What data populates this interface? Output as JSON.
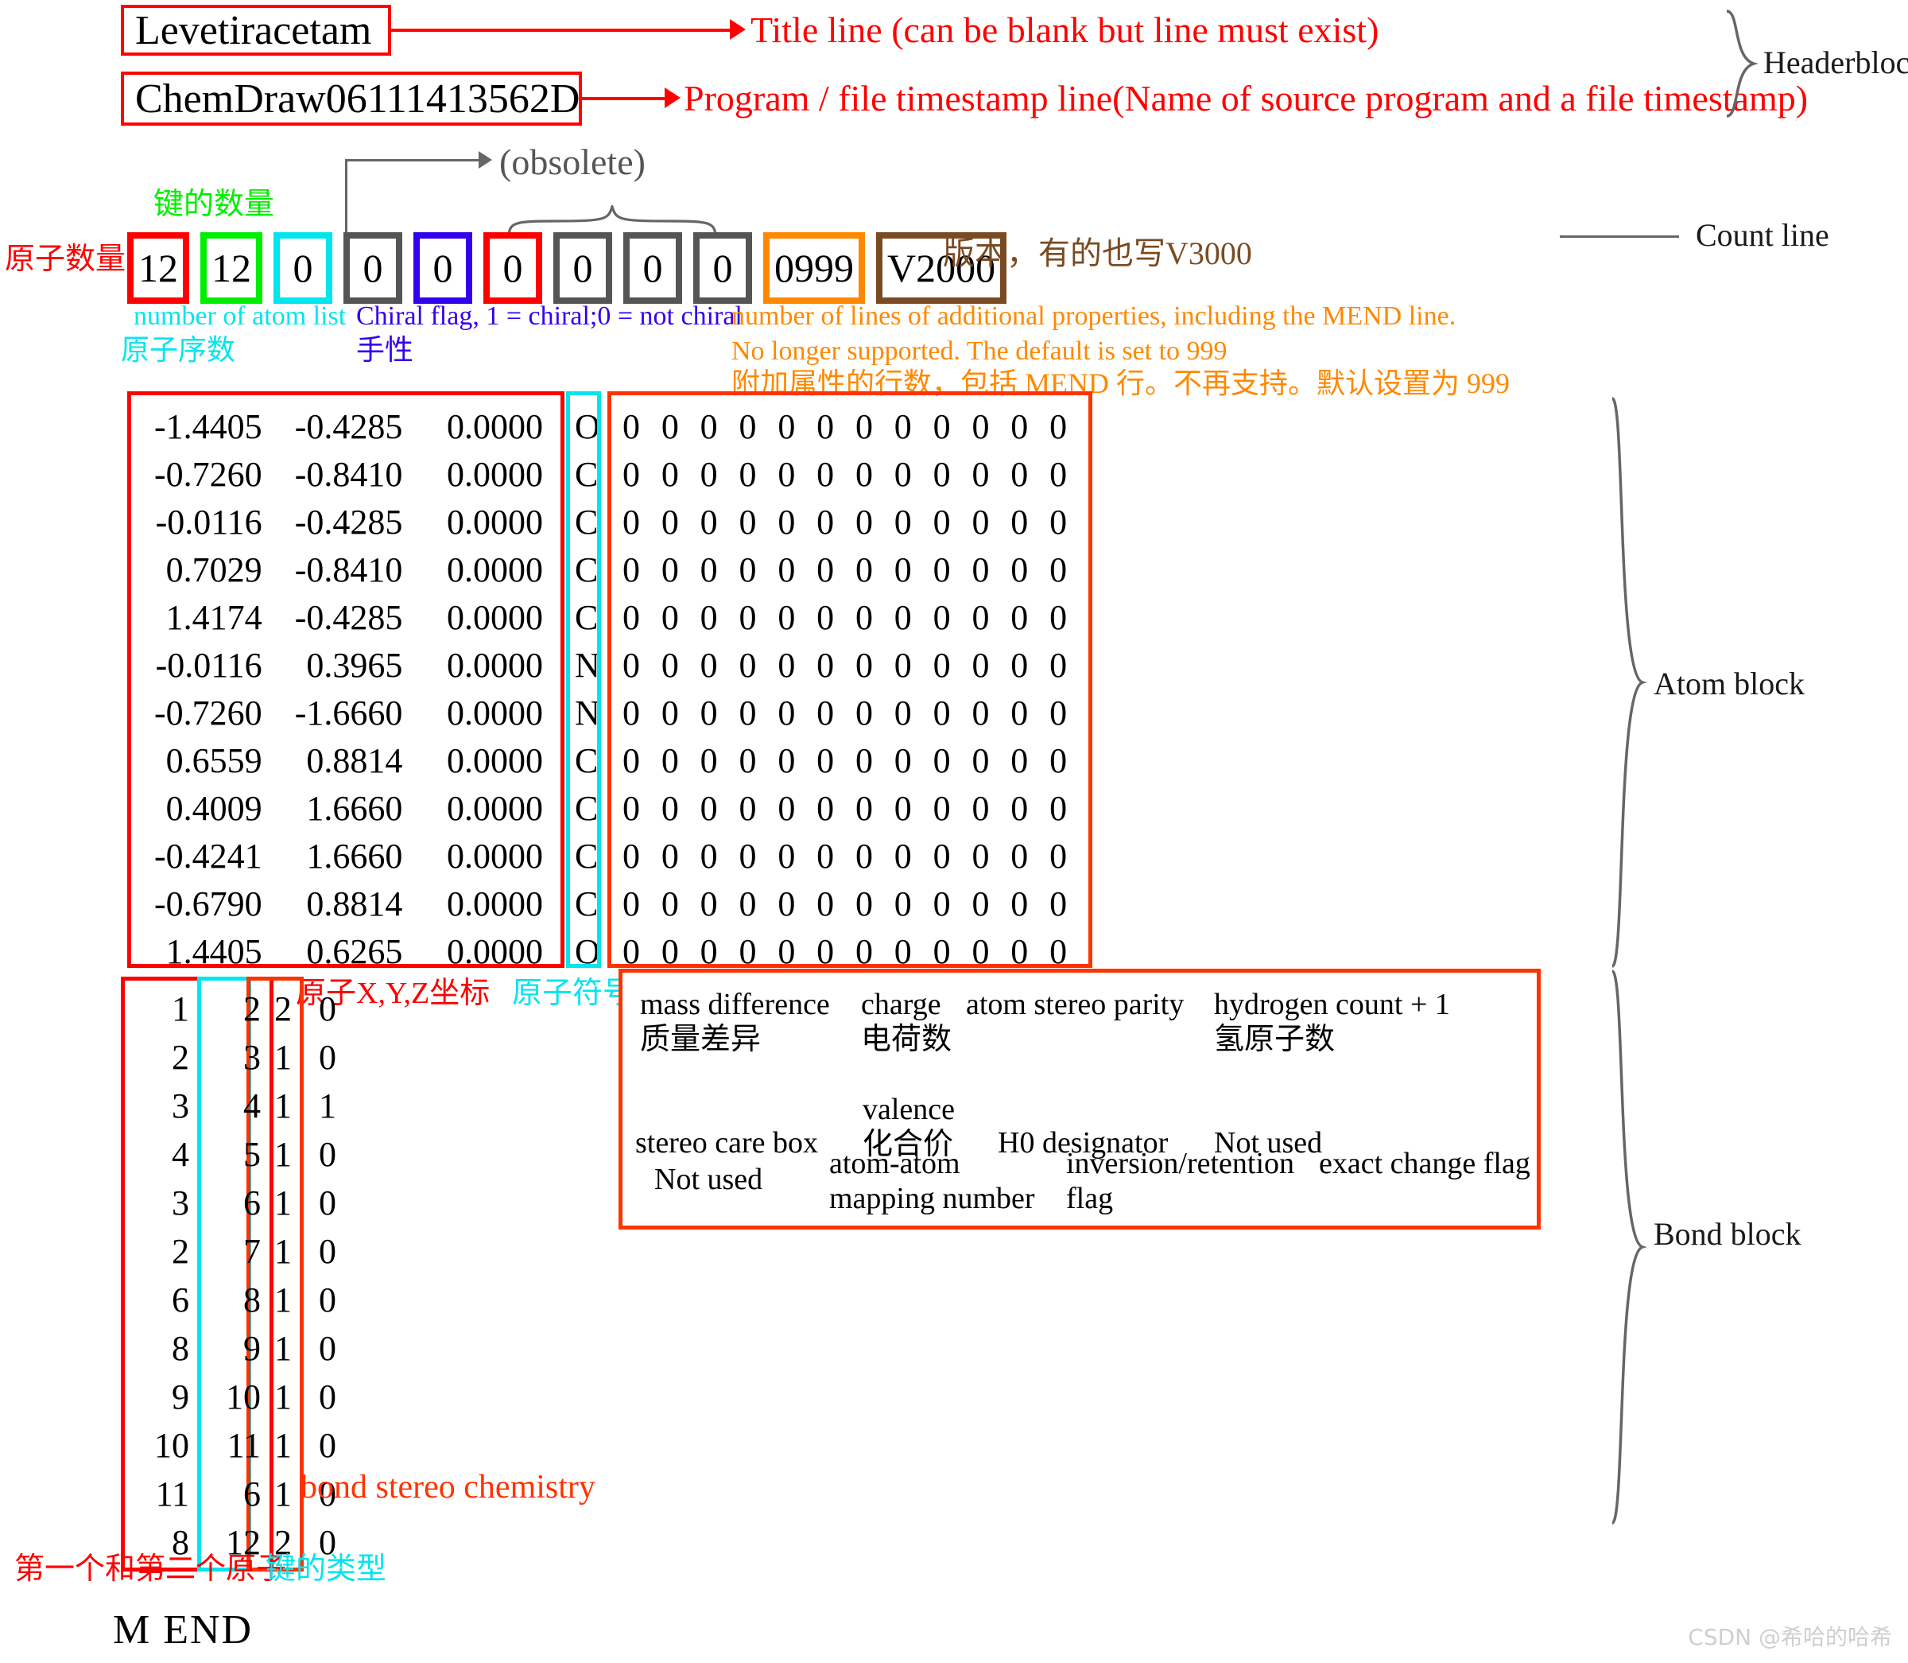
{
  "header": {
    "title_line": "Levetiracetam",
    "program_line": "ChemDraw06111413562D",
    "title_annotation": "Title line (can be blank but line must exist)",
    "program_annotation": "Program / file timestamp line(Name of source program and a file timestamp)",
    "block_label": "Headerblock"
  },
  "count_line": {
    "block_label": "Count line",
    "obsolete_label": "(obsolete)",
    "atoms_label_cn": "原子数量",
    "bonds_label_cn": "键的数量",
    "version_note_cn": "版本，有的也写V3000",
    "cells": [
      {
        "value": "12",
        "color": "#ff0000"
      },
      {
        "value": "12",
        "color": "#00ee00"
      },
      {
        "value": "0",
        "color": "#00e5ee"
      },
      {
        "value": "0",
        "color": "#555555"
      },
      {
        "value": "0",
        "color": "#3300ee"
      },
      {
        "value": "0",
        "color": "#ff0000"
      },
      {
        "value": "0",
        "color": "#555555"
      },
      {
        "value": "0",
        "color": "#555555"
      },
      {
        "value": "0",
        "color": "#555555"
      },
      {
        "value": "0999",
        "color": "#ff8800"
      },
      {
        "value": "V2000",
        "color": "#7a4b22"
      }
    ],
    "annotations": {
      "atom_list_en": "number of atom list",
      "atom_list_cn": "原子序数",
      "chiral_en": "Chiral flag, 1 = chiral;0 = not chiral",
      "chiral_cn": "手性",
      "props_en_1": "number of lines of additional properties, including the MEND line.",
      "props_en_2": "No longer supported. The default is set to 999",
      "props_cn": "附加属性的行数，包括 MEND 行。不再支持。默认设置为 999"
    }
  },
  "atom_block": {
    "block_label": "Atom block",
    "coords_label_cn": "原子X,Y,Z坐标",
    "symbol_label_cn": "原子符号",
    "zeros_per_row": 12,
    "rows": [
      {
        "x": "-1.4405",
        "y": "-0.4285",
        "z": "0.0000",
        "symbol": "O"
      },
      {
        "x": "-0.7260",
        "y": "-0.8410",
        "z": "0.0000",
        "symbol": "C"
      },
      {
        "x": "-0.0116",
        "y": "-0.4285",
        "z": "0.0000",
        "symbol": "C"
      },
      {
        "x": "0.7029",
        "y": "-0.8410",
        "z": "0.0000",
        "symbol": "C"
      },
      {
        "x": "1.4174",
        "y": "-0.4285",
        "z": "0.0000",
        "symbol": "C"
      },
      {
        "x": "-0.0116",
        "y": "0.3965",
        "z": "0.0000",
        "symbol": "N"
      },
      {
        "x": "-0.7260",
        "y": "-1.6660",
        "z": "0.0000",
        "symbol": "N"
      },
      {
        "x": "0.6559",
        "y": "0.8814",
        "z": "0.0000",
        "symbol": "C"
      },
      {
        "x": "0.4009",
        "y": "1.6660",
        "z": "0.0000",
        "symbol": "C"
      },
      {
        "x": "-0.4241",
        "y": "1.6660",
        "z": "0.0000",
        "symbol": "C"
      },
      {
        "x": "-0.6790",
        "y": "0.8814",
        "z": "0.0000",
        "symbol": "C"
      },
      {
        "x": "1.4405",
        "y": "0.6265",
        "z": "0.0000",
        "symbol": "O"
      }
    ]
  },
  "bond_block": {
    "block_label": "Bond block",
    "stereo_label_en": "bond stereo chemistry",
    "atoms_label_cn": "第一个和第二个原子",
    "type_label_cn": "键的类型",
    "rows": [
      {
        "a": "1",
        "b": "2",
        "type": "2",
        "stereo": "0"
      },
      {
        "a": "2",
        "b": "3",
        "type": "1",
        "stereo": "0"
      },
      {
        "a": "3",
        "b": "4",
        "type": "1",
        "stereo": "1"
      },
      {
        "a": "4",
        "b": "5",
        "type": "1",
        "stereo": "0"
      },
      {
        "a": "3",
        "b": "6",
        "type": "1",
        "stereo": "0"
      },
      {
        "a": "2",
        "b": "7",
        "type": "1",
        "stereo": "0"
      },
      {
        "a": "6",
        "b": "8",
        "type": "1",
        "stereo": "0"
      },
      {
        "a": "8",
        "b": "9",
        "type": "1",
        "stereo": "0"
      },
      {
        "a": "9",
        "b": "10",
        "type": "1",
        "stereo": "0"
      },
      {
        "a": "10",
        "b": "11",
        "type": "1",
        "stereo": "0"
      },
      {
        "a": "11",
        "b": "6",
        "type": "1",
        "stereo": "0"
      },
      {
        "a": "8",
        "b": "12",
        "type": "2",
        "stereo": "0"
      }
    ]
  },
  "properties_legend": {
    "row1": [
      {
        "en": "mass difference",
        "cn": "质量差异"
      },
      {
        "en": "charge",
        "cn": "电荷数"
      },
      {
        "en": "atom stereo parity",
        "cn": ""
      },
      {
        "en": "hydrogen count + 1",
        "cn": "氢原子数"
      }
    ],
    "row2": [
      {
        "en": "stereo care box",
        "cn": ""
      },
      {
        "en": "valence",
        "cn": "化合价"
      },
      {
        "en": "H0 designator",
        "cn": ""
      },
      {
        "en": "Not used",
        "cn": ""
      }
    ],
    "row3": [
      {
        "en": "Not used",
        "cn": ""
      },
      {
        "en": "atom-atom",
        "cn": "mapping number"
      },
      {
        "en": "inversion/retention",
        "cn": "flag"
      },
      {
        "en": "exact change flag",
        "cn": ""
      }
    ]
  },
  "footer": {
    "mend": "M  END",
    "watermark": "CSDN @希哈的哈希"
  }
}
